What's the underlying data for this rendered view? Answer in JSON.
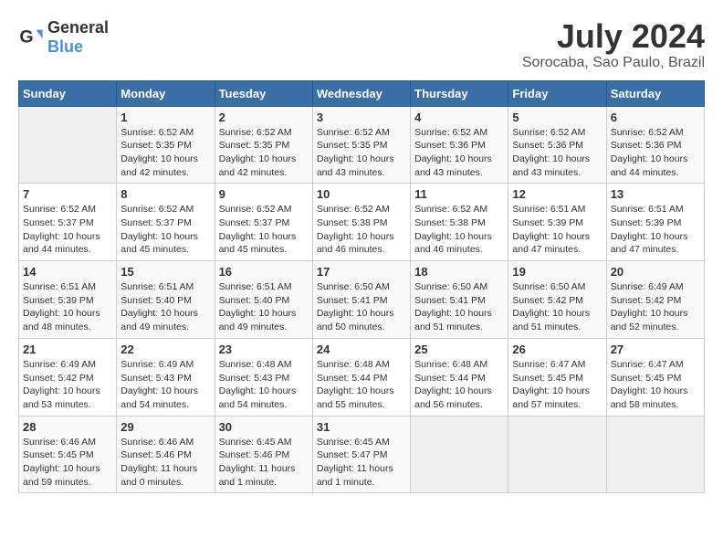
{
  "header": {
    "logo_general": "General",
    "logo_blue": "Blue",
    "title": "July 2024",
    "subtitle": "Sorocaba, Sao Paulo, Brazil"
  },
  "calendar": {
    "days_of_week": [
      "Sunday",
      "Monday",
      "Tuesday",
      "Wednesday",
      "Thursday",
      "Friday",
      "Saturday"
    ],
    "weeks": [
      [
        {
          "day": "",
          "info": ""
        },
        {
          "day": "1",
          "info": "Sunrise: 6:52 AM\nSunset: 5:35 PM\nDaylight: 10 hours\nand 42 minutes."
        },
        {
          "day": "2",
          "info": "Sunrise: 6:52 AM\nSunset: 5:35 PM\nDaylight: 10 hours\nand 42 minutes."
        },
        {
          "day": "3",
          "info": "Sunrise: 6:52 AM\nSunset: 5:35 PM\nDaylight: 10 hours\nand 43 minutes."
        },
        {
          "day": "4",
          "info": "Sunrise: 6:52 AM\nSunset: 5:36 PM\nDaylight: 10 hours\nand 43 minutes."
        },
        {
          "day": "5",
          "info": "Sunrise: 6:52 AM\nSunset: 5:36 PM\nDaylight: 10 hours\nand 43 minutes."
        },
        {
          "day": "6",
          "info": "Sunrise: 6:52 AM\nSunset: 5:36 PM\nDaylight: 10 hours\nand 44 minutes."
        }
      ],
      [
        {
          "day": "7",
          "info": "Sunrise: 6:52 AM\nSunset: 5:37 PM\nDaylight: 10 hours\nand 44 minutes."
        },
        {
          "day": "8",
          "info": "Sunrise: 6:52 AM\nSunset: 5:37 PM\nDaylight: 10 hours\nand 45 minutes."
        },
        {
          "day": "9",
          "info": "Sunrise: 6:52 AM\nSunset: 5:37 PM\nDaylight: 10 hours\nand 45 minutes."
        },
        {
          "day": "10",
          "info": "Sunrise: 6:52 AM\nSunset: 5:38 PM\nDaylight: 10 hours\nand 46 minutes."
        },
        {
          "day": "11",
          "info": "Sunrise: 6:52 AM\nSunset: 5:38 PM\nDaylight: 10 hours\nand 46 minutes."
        },
        {
          "day": "12",
          "info": "Sunrise: 6:51 AM\nSunset: 5:39 PM\nDaylight: 10 hours\nand 47 minutes."
        },
        {
          "day": "13",
          "info": "Sunrise: 6:51 AM\nSunset: 5:39 PM\nDaylight: 10 hours\nand 47 minutes."
        }
      ],
      [
        {
          "day": "14",
          "info": "Sunrise: 6:51 AM\nSunset: 5:39 PM\nDaylight: 10 hours\nand 48 minutes."
        },
        {
          "day": "15",
          "info": "Sunrise: 6:51 AM\nSunset: 5:40 PM\nDaylight: 10 hours\nand 49 minutes."
        },
        {
          "day": "16",
          "info": "Sunrise: 6:51 AM\nSunset: 5:40 PM\nDaylight: 10 hours\nand 49 minutes."
        },
        {
          "day": "17",
          "info": "Sunrise: 6:50 AM\nSunset: 5:41 PM\nDaylight: 10 hours\nand 50 minutes."
        },
        {
          "day": "18",
          "info": "Sunrise: 6:50 AM\nSunset: 5:41 PM\nDaylight: 10 hours\nand 51 minutes."
        },
        {
          "day": "19",
          "info": "Sunrise: 6:50 AM\nSunset: 5:42 PM\nDaylight: 10 hours\nand 51 minutes."
        },
        {
          "day": "20",
          "info": "Sunrise: 6:49 AM\nSunset: 5:42 PM\nDaylight: 10 hours\nand 52 minutes."
        }
      ],
      [
        {
          "day": "21",
          "info": "Sunrise: 6:49 AM\nSunset: 5:42 PM\nDaylight: 10 hours\nand 53 minutes."
        },
        {
          "day": "22",
          "info": "Sunrise: 6:49 AM\nSunset: 5:43 PM\nDaylight: 10 hours\nand 54 minutes."
        },
        {
          "day": "23",
          "info": "Sunrise: 6:48 AM\nSunset: 5:43 PM\nDaylight: 10 hours\nand 54 minutes."
        },
        {
          "day": "24",
          "info": "Sunrise: 6:48 AM\nSunset: 5:44 PM\nDaylight: 10 hours\nand 55 minutes."
        },
        {
          "day": "25",
          "info": "Sunrise: 6:48 AM\nSunset: 5:44 PM\nDaylight: 10 hours\nand 56 minutes."
        },
        {
          "day": "26",
          "info": "Sunrise: 6:47 AM\nSunset: 5:45 PM\nDaylight: 10 hours\nand 57 minutes."
        },
        {
          "day": "27",
          "info": "Sunrise: 6:47 AM\nSunset: 5:45 PM\nDaylight: 10 hours\nand 58 minutes."
        }
      ],
      [
        {
          "day": "28",
          "info": "Sunrise: 6:46 AM\nSunset: 5:45 PM\nDaylight: 10 hours\nand 59 minutes."
        },
        {
          "day": "29",
          "info": "Sunrise: 6:46 AM\nSunset: 5:46 PM\nDaylight: 11 hours\nand 0 minutes."
        },
        {
          "day": "30",
          "info": "Sunrise: 6:45 AM\nSunset: 5:46 PM\nDaylight: 11 hours\nand 1 minute."
        },
        {
          "day": "31",
          "info": "Sunrise: 6:45 AM\nSunset: 5:47 PM\nDaylight: 11 hours\nand 1 minute."
        },
        {
          "day": "",
          "info": ""
        },
        {
          "day": "",
          "info": ""
        },
        {
          "day": "",
          "info": ""
        }
      ]
    ]
  }
}
